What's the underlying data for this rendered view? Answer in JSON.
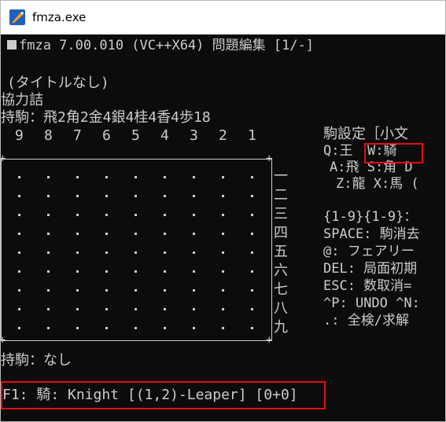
{
  "window": {
    "title": "fmza.exe"
  },
  "console": {
    "header": "fmza 7.00.010 (VC++X64) 問題編集 [1/-]",
    "title_line": "(タイトルなし)",
    "genre": "協力詰",
    "hand_top": "持駒：飛2角2金4銀4桂4香4歩18",
    "files": [
      "9",
      "8",
      "7",
      "6",
      "5",
      "4",
      "3",
      "2",
      "1"
    ],
    "ranks": [
      "一",
      "二",
      "三",
      "四",
      "五",
      "六",
      "七",
      "八",
      "九"
    ],
    "hand_bottom": "持駒：なし",
    "status_line": "F1: 騎: Knight [(1,2)-Leaper] [0+0]"
  },
  "help_panel": {
    "heading": "駒設定［小文",
    "row1_q": "Q:王",
    "row1_w": "W:騎",
    "row2": "A:飛 S:角 D",
    "row3": "Z:龍 X:馬 (",
    "row4": "{1-9}{1-9}：",
    "row5": "SPACE: 駒消去",
    "row6": "@: フェアリー",
    "row7": "DEL: 局面初期",
    "row8": "ESC: 数取消=",
    "row9": "^P: UNDO ^N:",
    "row10": ".: 全検/求解"
  },
  "colors": {
    "console_bg": "#0c0c0c",
    "text": "#cccccc",
    "highlight_border": "#e01010",
    "icon_blue": "#1f5fbf"
  }
}
